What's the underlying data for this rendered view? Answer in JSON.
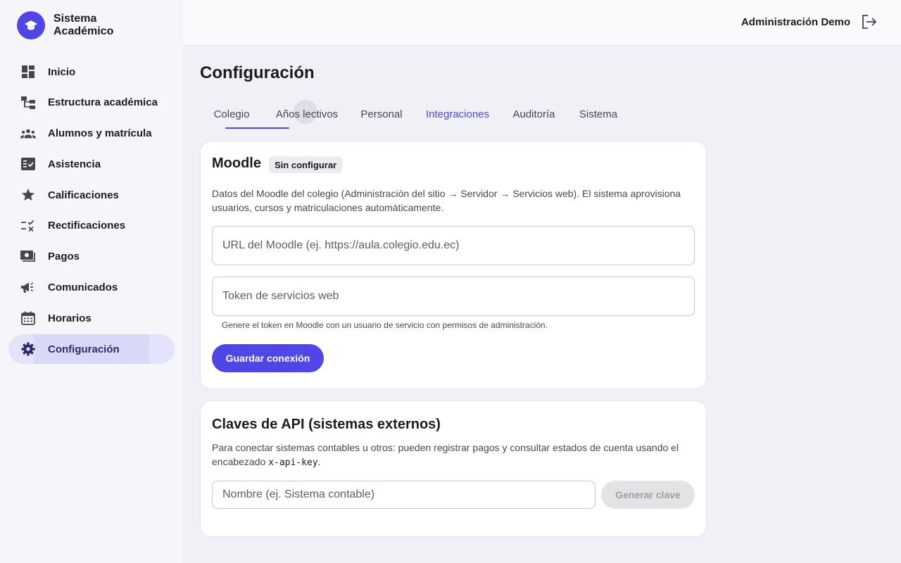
{
  "brand": {
    "name": "Sistema Académico",
    "logo_icon": "graduation-cap-icon"
  },
  "sidebar": {
    "items": [
      {
        "label": "Inicio",
        "icon": "dashboard-icon"
      },
      {
        "label": "Estructura académica",
        "icon": "structure-icon"
      },
      {
        "label": "Alumnos y matrícula",
        "icon": "people-icon"
      },
      {
        "label": "Asistencia",
        "icon": "fact-check-icon"
      },
      {
        "label": "Calificaciones",
        "icon": "star-icon"
      },
      {
        "label": "Rectificaciones",
        "icon": "rule-icon"
      },
      {
        "label": "Pagos",
        "icon": "payments-icon"
      },
      {
        "label": "Comunicados",
        "icon": "campaign-icon"
      },
      {
        "label": "Horarios",
        "icon": "calendar-icon"
      },
      {
        "label": "Configuración",
        "icon": "gear-icon",
        "active": true
      }
    ]
  },
  "topbar": {
    "user": "Administración Demo",
    "logout_icon": "logout-icon"
  },
  "page": {
    "title": "Configuración"
  },
  "tabs": [
    {
      "label": "Colegio"
    },
    {
      "label": "Años lectivos"
    },
    {
      "label": "Personal"
    },
    {
      "label": "Integraciones",
      "current": true
    },
    {
      "label": "Auditoría"
    },
    {
      "label": "Sistema"
    }
  ],
  "moodle": {
    "title": "Moodle",
    "status": "Sin configurar",
    "description": "Datos del Moodle del colegio (Administración del sitio → Servidor → Servicios web). El sistema aprovisiona usuarios, cursos y matriculaciones automáticamente.",
    "url_placeholder": "URL del Moodle (ej. https://aula.colegio.edu.ec)",
    "token_placeholder": "Token de servicios web",
    "hint": "Genere el token en Moodle con un usuario de servicio con permisos de administración.",
    "save_label": "Guardar conexión"
  },
  "api_keys": {
    "title": "Claves de API (sistemas externos)",
    "description_before": "Para conectar sistemas contables u otros: pueden registrar pagos y consultar estados de cuenta usando el encabezado ",
    "header_code": "x-api-key",
    "description_after": ".",
    "name_placeholder": "Nombre (ej. Sistema contable)",
    "generate_label": "Generar clave"
  },
  "colors": {
    "accent": "#4f46e5",
    "active_bg": "#e3e3fb"
  }
}
